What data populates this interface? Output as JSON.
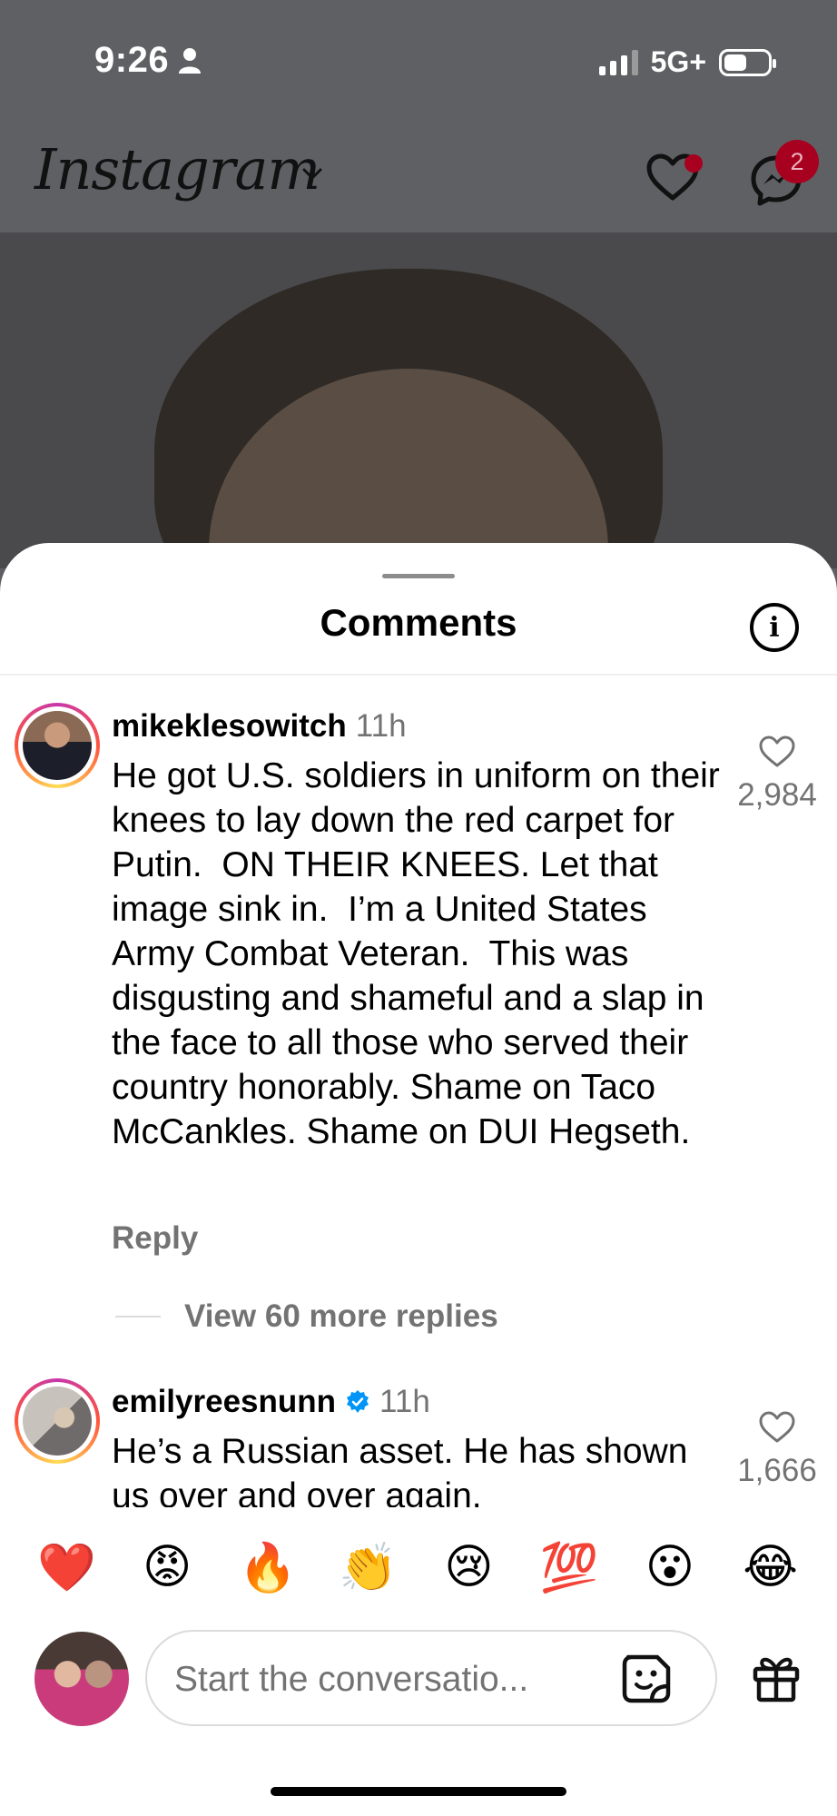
{
  "status_bar": {
    "time": "9:26",
    "network": "5G+"
  },
  "header": {
    "app_name": "Instagram",
    "messages_badge": "2",
    "icons": [
      "chevron-down-icon",
      "heart-icon",
      "messenger-icon"
    ],
    "colors": {
      "badge": "#a8001f"
    }
  },
  "comments_sheet": {
    "title": "Comments",
    "info_icon": "i",
    "comments": [
      {
        "username": "mikeklesowitch",
        "time": "11h",
        "text": "He got U.S. soldiers in uniform on their knees to lay down the red carpet for Putin.  ON THEIR KNEES. Let that image sink in.  I’m a United States Army Combat Veteran.  This was disgusting and shameful and a slap in the face to all those who served their country honorably. Shame on Taco McCankles. Shame on DUI Hegseth.",
        "likes": "2,984",
        "reply_label": "Reply",
        "view_replies": "View 60 more replies",
        "verified": false
      },
      {
        "username": "emilyreesnunn",
        "time": "11h",
        "text": "He’s a Russian asset. He has shown us over and over again.",
        "likes": "1,666",
        "verified": true
      }
    ]
  },
  "composer": {
    "reactions": [
      "❤️",
      "😡",
      "🔥",
      "👏",
      "😢",
      "💯",
      "😮",
      "😂"
    ],
    "placeholder": "Start the conversatio...",
    "icons": [
      "sticker-icon",
      "gift-icon"
    ]
  }
}
